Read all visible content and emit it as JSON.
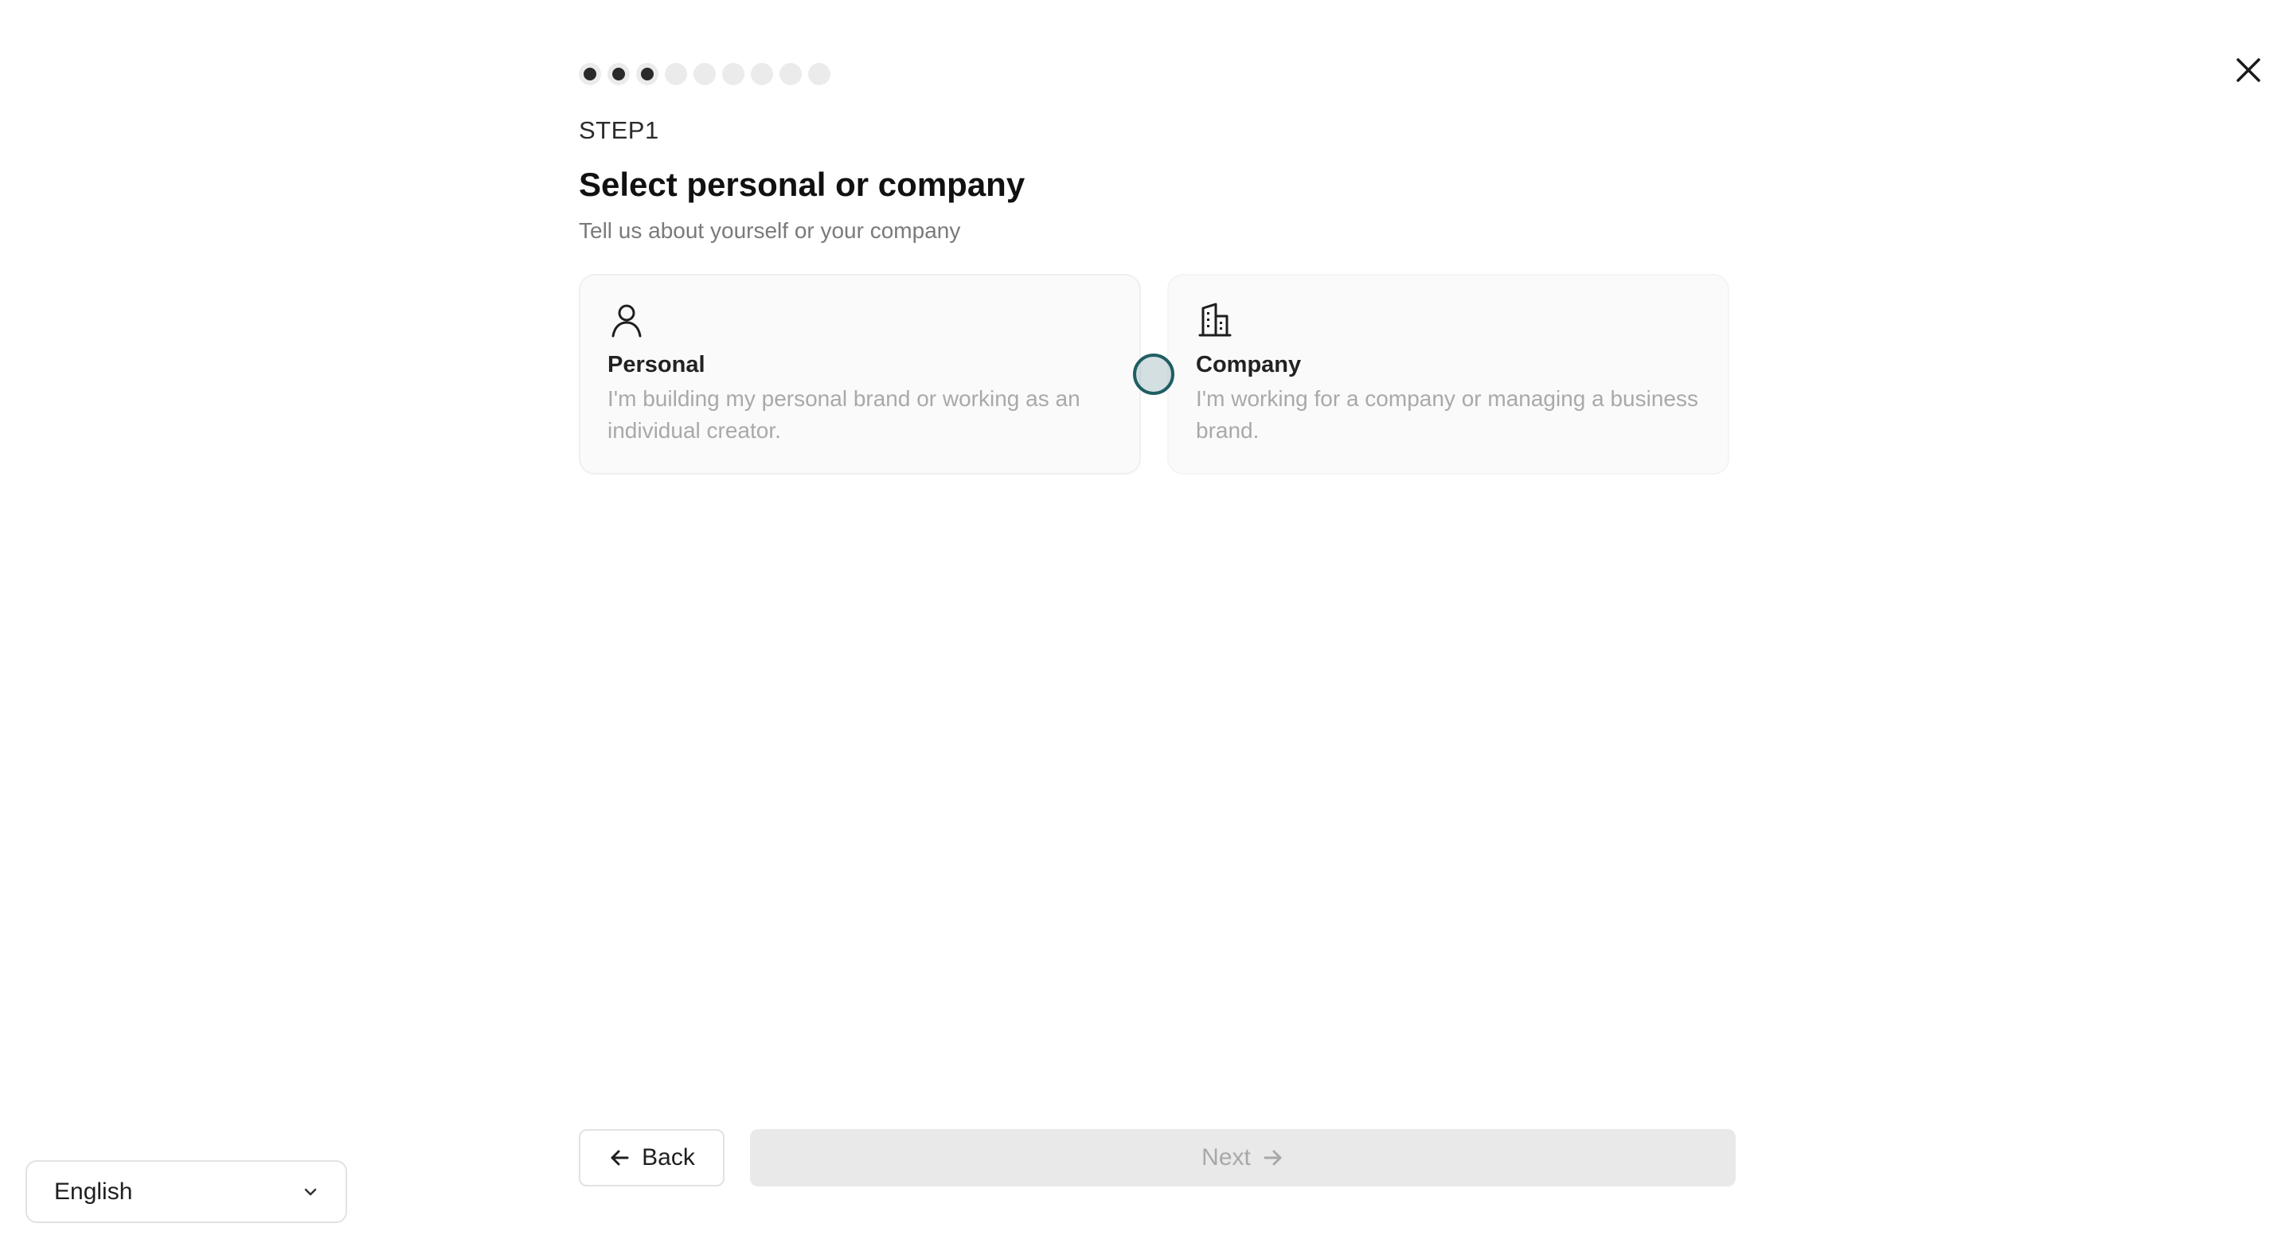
{
  "progress": {
    "total_steps": 9,
    "completed_steps": 3
  },
  "step_label": "STEP1",
  "title": "Select personal or company",
  "subtitle": "Tell us about yourself or your company",
  "options": [
    {
      "icon": "user-icon",
      "title": "Personal",
      "description": "I'm building my personal brand or working as an individual creator."
    },
    {
      "icon": "building-icon",
      "title": "Company",
      "description": "I'm working for a company or managing a business brand."
    }
  ],
  "buttons": {
    "back_label": "Back",
    "next_label": "Next"
  },
  "language": {
    "selected": "English"
  },
  "colors": {
    "dot_done": "#2a2a2a",
    "dot_pending": "#ebebeb",
    "cursor_ring": "#1f5f63",
    "next_disabled_bg": "#e9e9e9"
  }
}
